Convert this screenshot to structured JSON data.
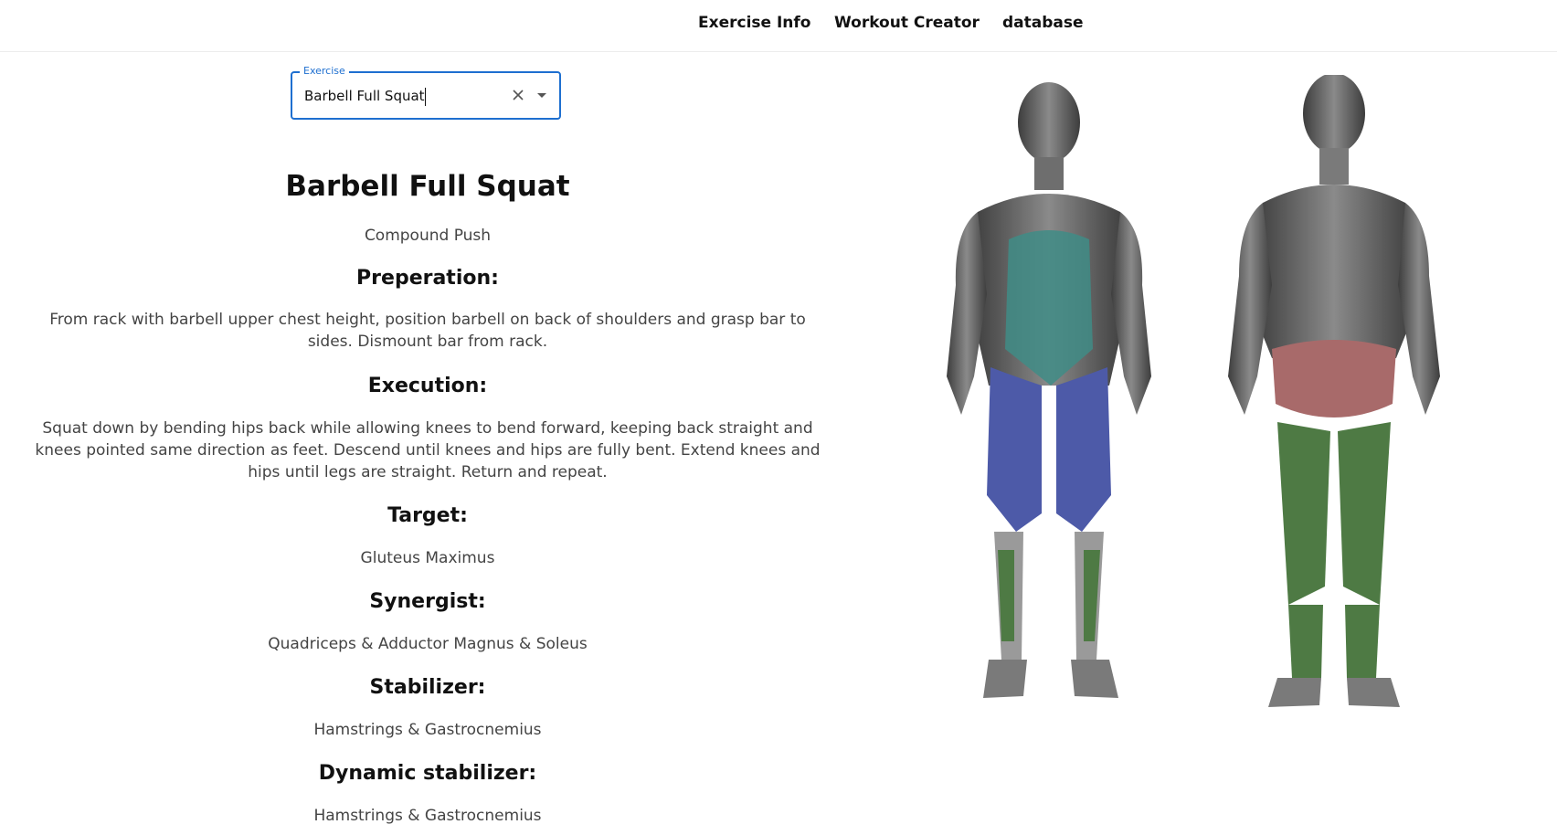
{
  "nav": {
    "items": [
      {
        "label": "Exercise Info"
      },
      {
        "label": "Workout Creator"
      },
      {
        "label": "database"
      }
    ]
  },
  "search": {
    "legend": "Exercise",
    "value": "Barbell Full Squat"
  },
  "exercise": {
    "name": "Barbell Full Squat",
    "type": "Compound Push",
    "preparation_heading": "Preperation:",
    "preparation_text": "From rack with barbell upper chest height, position barbell on back of shoulders and grasp bar to sides. Dismount bar from rack.",
    "execution_heading": "Execution:",
    "execution_text": "Squat down by bending hips back while allowing knees to bend forward, keeping back straight and knees pointed same direction as feet. Descend until knees and hips are fully bent. Extend knees and hips until legs are straight. Return and repeat.",
    "target_heading": "Target:",
    "target": "Gluteus Maximus",
    "synergist_heading": "Synergist:",
    "synergist": "Quadriceps & Adductor Magnus & Soleus",
    "stabilizer_heading": "Stabilizer:",
    "stabilizer": "Hamstrings & Gastrocnemius",
    "dynamic_stabilizer_heading": "Dynamic stabilizer:",
    "dynamic_stabilizer": "Hamstrings & Gastrocnemius"
  },
  "icons": {
    "clear": "close-icon",
    "dropdown": "caret-down-icon"
  },
  "colors": {
    "accent": "#1e6fd0",
    "target_muscle": "#a86a6a",
    "synergist_muscle": "#4d5aa8",
    "stabilizer_muscle": "#4e7a44",
    "dynamic_stabilizer_muscle": "#3f8c86",
    "body": "#5a5a5a"
  }
}
